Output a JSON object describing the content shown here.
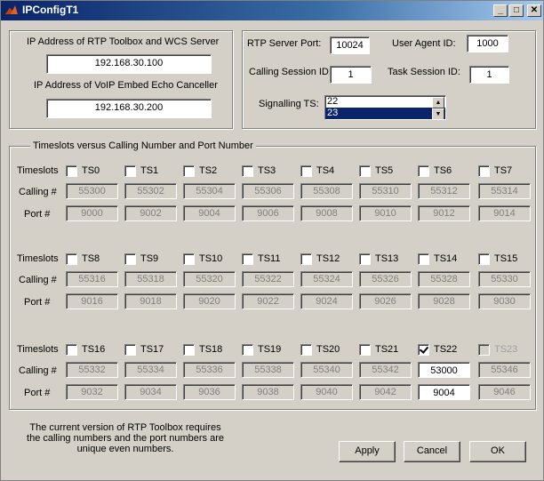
{
  "window": {
    "title": "IPConfigT1",
    "minimize": "_",
    "maximize": "□",
    "close": "✕"
  },
  "ip_panel": {
    "rtp_label": "IP Address of RTP Toolbox and WCS Server",
    "rtp_value": "192.168.30.100",
    "voip_label": "IP Address of VoIP Embed Echo Canceller",
    "voip_value": "192.168.30.200"
  },
  "session_panel": {
    "server_port_label": "RTP  Server Port:",
    "server_port_value": "10024",
    "user_agent_label": "User Agent ID:",
    "user_agent_value": "1000",
    "calling_session_label": "Calling Session ID:",
    "calling_session_value": "1",
    "task_session_label": "Task Session ID:",
    "task_session_value": "1",
    "signalling_label": "Signalling TS:",
    "signalling_options": [
      "22",
      "23"
    ],
    "signalling_selected": "23"
  },
  "timeslots": {
    "group_label": "Timeslots versus Calling Number and Port Number",
    "row_labels": {
      "timeslots": "Timeslots",
      "calling": "Calling #",
      "port": "Port #"
    },
    "groups": [
      {
        "slots": [
          {
            "ts": "TS0",
            "calling": "55300",
            "port": "9000"
          },
          {
            "ts": "TS1",
            "calling": "55302",
            "port": "9002"
          },
          {
            "ts": "TS2",
            "calling": "55304",
            "port": "9004"
          },
          {
            "ts": "TS3",
            "calling": "55306",
            "port": "9006"
          },
          {
            "ts": "TS4",
            "calling": "55308",
            "port": "9008"
          },
          {
            "ts": "TS5",
            "calling": "55310",
            "port": "9010"
          },
          {
            "ts": "TS6",
            "calling": "55312",
            "port": "9012"
          },
          {
            "ts": "TS7",
            "calling": "55314",
            "port": "9014"
          }
        ]
      },
      {
        "slots": [
          {
            "ts": "TS8",
            "calling": "55316",
            "port": "9016"
          },
          {
            "ts": "TS9",
            "calling": "55318",
            "port": "9018"
          },
          {
            "ts": "TS10",
            "calling": "55320",
            "port": "9020"
          },
          {
            "ts": "TS11",
            "calling": "55322",
            "port": "9022"
          },
          {
            "ts": "TS12",
            "calling": "55324",
            "port": "9024"
          },
          {
            "ts": "TS13",
            "calling": "55326",
            "port": "9026"
          },
          {
            "ts": "TS14",
            "calling": "55328",
            "port": "9028"
          },
          {
            "ts": "TS15",
            "calling": "55330",
            "port": "9030"
          }
        ]
      },
      {
        "slots": [
          {
            "ts": "TS16",
            "calling": "55332",
            "port": "9032"
          },
          {
            "ts": "TS17",
            "calling": "55334",
            "port": "9034"
          },
          {
            "ts": "TS18",
            "calling": "55336",
            "port": "9036"
          },
          {
            "ts": "TS19",
            "calling": "55338",
            "port": "9038"
          },
          {
            "ts": "TS20",
            "calling": "55340",
            "port": "9040"
          },
          {
            "ts": "TS21",
            "calling": "55342",
            "port": "9042"
          },
          {
            "ts": "TS22",
            "calling": "53000",
            "port": "9004",
            "checked": true
          },
          {
            "ts": "TS23",
            "calling": "55346",
            "port": "9046",
            "disabled": true
          }
        ]
      }
    ]
  },
  "note": {
    "line1": "The current version of RTP Toolbox requires",
    "line2": "the calling numbers and the port numbers are",
    "line3": "unique even numbers."
  },
  "buttons": {
    "apply": "Apply",
    "cancel": "Cancel",
    "ok": "OK"
  }
}
